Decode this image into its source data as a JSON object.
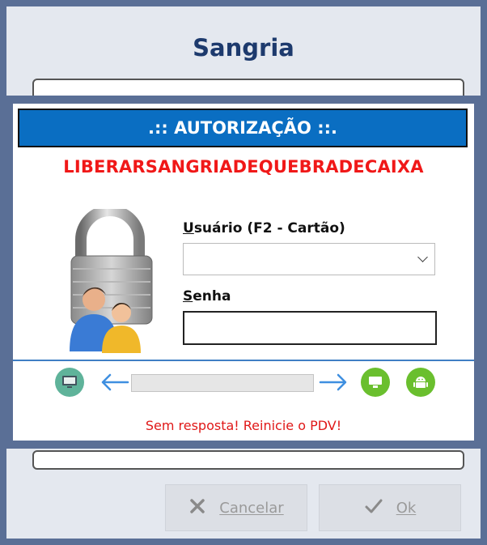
{
  "window": {
    "title": "Sangria"
  },
  "dialog": {
    "header": ".:: AUTORIZAÇÃO ::.",
    "auth_code": "LIBERARSANGRIADEQUEBRADECAIXA",
    "user_label_hotkey": "U",
    "user_label_rest": "suário (F2 - Cartão)",
    "user_value": "",
    "password_label_hotkey": "S",
    "password_label_rest": "enha",
    "password_value": "",
    "progress_percent": 0,
    "status_message": "Sem resposta! Reinicie o PDV!"
  },
  "buttons": {
    "cancel_label": "Cancelar",
    "ok_label": "Ok"
  },
  "icons": {
    "lock": "padlock-users-icon",
    "pc": "monitor-icon",
    "arrow_left": "arrow-left-icon",
    "arrow_right": "arrow-right-icon",
    "server": "server-icon",
    "android": "android-icon",
    "cancel": "x-icon",
    "ok": "check-icon"
  },
  "colors": {
    "frame": "#5a6f96",
    "header_bg": "#0a6ec2",
    "alert_red": "#f01818",
    "title_navy": "#1d3a6d",
    "green": "#6abf2e"
  }
}
